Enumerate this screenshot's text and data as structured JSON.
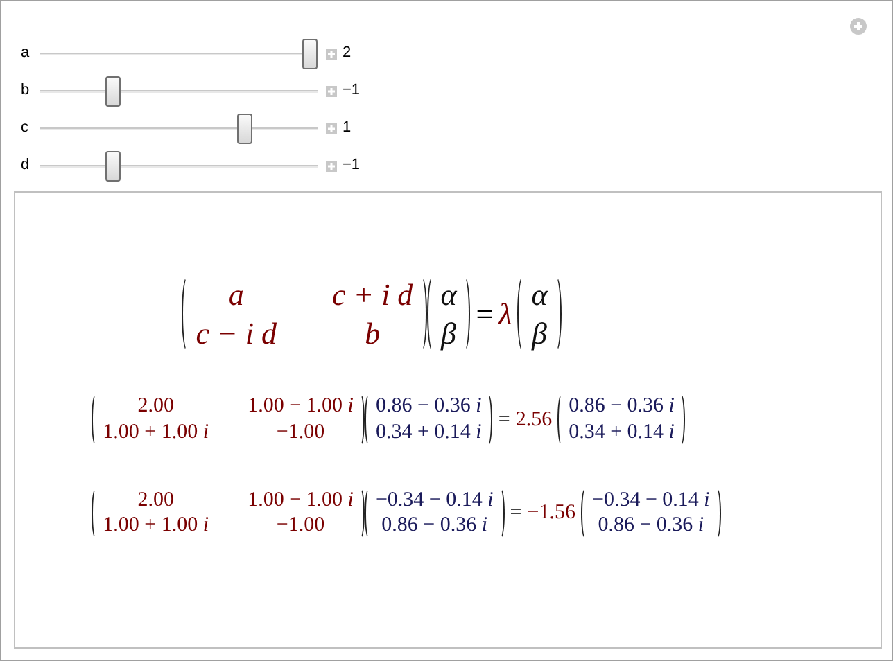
{
  "controls": [
    {
      "label": "a",
      "level": 1,
      "value": "2"
    },
    {
      "label": "b",
      "level": 0.25,
      "value": "−1"
    },
    {
      "label": "c",
      "level": 0.75,
      "value": "1"
    },
    {
      "label": "d",
      "level": 0.25,
      "value": "−1"
    }
  ],
  "symbolic": {
    "matrix": [
      [
        "a",
        "c + i d"
      ],
      [
        "c − i d",
        "b"
      ]
    ],
    "vector": [
      "α",
      "β"
    ],
    "equals": "=",
    "eigenvalue": "λ",
    "vector2": [
      "α",
      "β"
    ]
  },
  "numeric": [
    {
      "matrix": [
        [
          "2.00",
          "1.00 − 1.00 *i*"
        ],
        [
          "1.00 + 1.00 *i*",
          "−1.00"
        ]
      ],
      "vector": [
        "0.86 − 0.36 *i*",
        "0.34 + 0.14 *i*"
      ],
      "equals": "=",
      "eigenvalue": "2.56",
      "vector2": [
        "0.86 − 0.36 *i*",
        "0.34 + 0.14 *i*"
      ]
    },
    {
      "matrix": [
        [
          "2.00",
          "1.00 − 1.00 *i*"
        ],
        [
          "1.00 + 1.00 *i*",
          "−1.00"
        ]
      ],
      "vector": [
        "−0.34 − 0.14 *i*",
        "0.86 − 0.36 *i*"
      ],
      "equals": "=",
      "eigenvalue": "−1.56",
      "vector2": [
        "−0.34 − 0.14 *i*",
        "0.86 − 0.36 *i*"
      ]
    }
  ]
}
